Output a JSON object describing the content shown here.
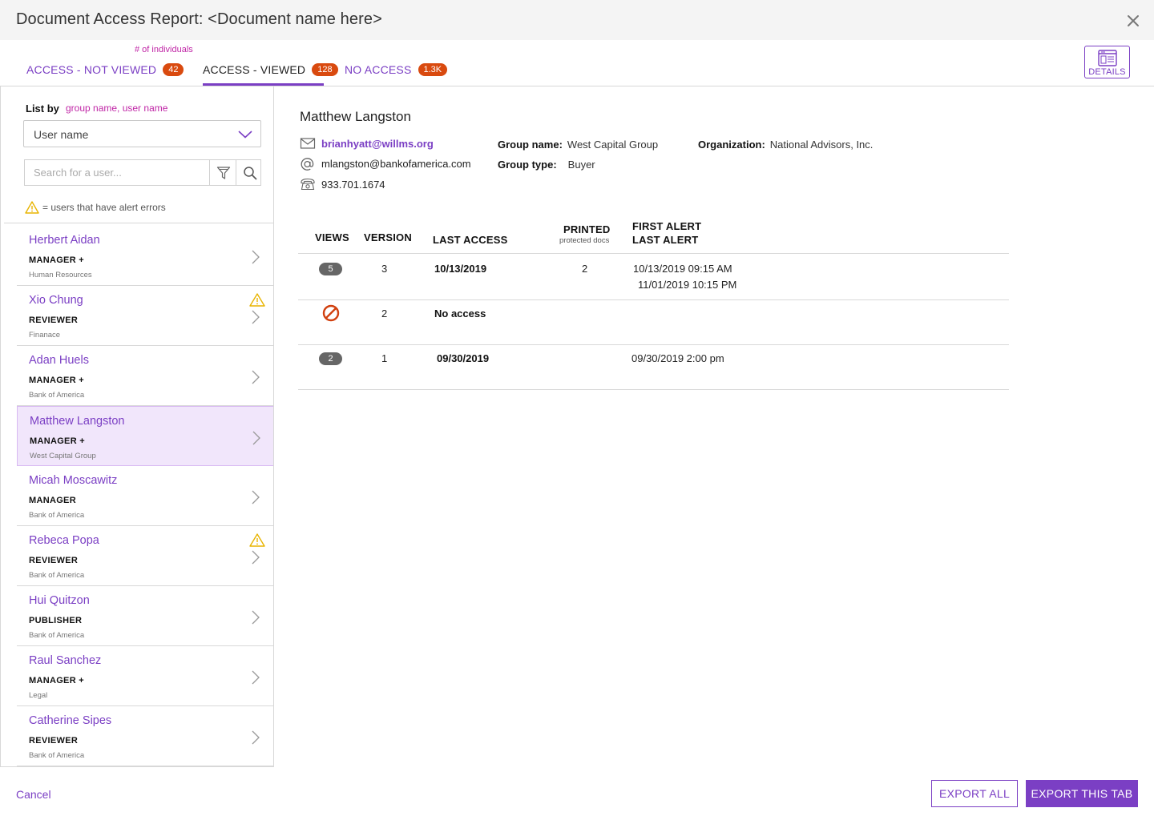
{
  "window": {
    "title": "Document Access Report: <Document name here>",
    "close_icon": "close-icon"
  },
  "tabs": {
    "hint": "# of individuals",
    "items": [
      {
        "label": "ACCESS - NOT VIEWED",
        "count": "42",
        "active": false
      },
      {
        "label": "ACCESS - VIEWED",
        "count": "128",
        "active": true
      },
      {
        "label": "NO ACCESS",
        "count": "1.3K",
        "active": false
      }
    ],
    "details_label": "DETAILS",
    "details_icon": "window-layout-icon"
  },
  "sidebar": {
    "list_by_label": "List by",
    "list_by_hint": "group name, user name",
    "select_value": "User name",
    "search_placeholder": "Search for a user...",
    "filter_icon": "filter-icon",
    "search_icon": "search-icon",
    "legend_text": "= users that have alert errors",
    "users": [
      {
        "name": "Herbert Aidan",
        "role": "MANAGER +",
        "org": "Human Resources",
        "alert": false,
        "selected": false
      },
      {
        "name": "Xio Chung",
        "role": "REVIEWER",
        "org": "Finanace",
        "alert": true,
        "selected": false
      },
      {
        "name": "Adan Huels",
        "role": "MANAGER +",
        "org": "Bank of America",
        "alert": false,
        "selected": false
      },
      {
        "name": "Matthew Langston",
        "role": "MANAGER +",
        "org": "West Capital Group",
        "alert": false,
        "selected": true
      },
      {
        "name": "Micah Moscawitz",
        "role": "MANAGER",
        "org": "Bank of America",
        "alert": false,
        "selected": false
      },
      {
        "name": "Rebeca Popa",
        "role": "REVIEWER",
        "org": "Bank of America",
        "alert": true,
        "selected": false
      },
      {
        "name": "Hui Quitzon",
        "role": "PUBLISHER",
        "org": "Bank of America",
        "alert": false,
        "selected": false
      },
      {
        "name": "Raul Sanchez",
        "role": "MANAGER +",
        "org": "Legal",
        "alert": false,
        "selected": false
      },
      {
        "name": "Catherine Sipes",
        "role": "REVIEWER",
        "org": "Bank of America",
        "alert": false,
        "selected": false
      }
    ]
  },
  "detail": {
    "name": "Matthew Langston",
    "email_link": "brianhyatt@willms.org",
    "email_alt": "mlangston@bankofamerica.com",
    "phone": "933.701.1674",
    "group_name_label": "Group name:",
    "group_name": "West Capital Group",
    "group_type_label": "Group type:",
    "group_type": "Buyer",
    "organization_label": "Organization:",
    "organization": "National Advisors, Inc.",
    "table": {
      "headers": {
        "views": "VIEWS",
        "version": "VERSION",
        "last_access": "LAST ACCESS",
        "printed": "PRINTED",
        "printed_sub": "protected docs",
        "first_alert": "FIRST ALERT",
        "last_alert": "LAST ALERT"
      },
      "rows": [
        {
          "views": "5",
          "version": "3",
          "last_access": "10/13/2019",
          "printed": "2",
          "first_alert": "10/13/2019 09:15 AM",
          "last_alert": "11/01/2019 10:15 PM"
        },
        {
          "views": "",
          "version": "2",
          "last_access": "No access",
          "printed": "",
          "first_alert": "",
          "last_alert": ""
        },
        {
          "views": "2",
          "version": "1",
          "last_access": "09/30/2019",
          "printed": "",
          "first_alert": "09/30/2019 2:00 pm",
          "last_alert": ""
        }
      ]
    }
  },
  "footer": {
    "cancel": "Cancel",
    "export_all": "EXPORT ALL",
    "export_tab": "EXPORT THIS TAB"
  },
  "colors": {
    "accent": "#7b3fc4",
    "badge": "#d94a0f",
    "hint": "#c026a6",
    "selected_bg": "#f1e6fb",
    "warning": "#e8b400"
  }
}
